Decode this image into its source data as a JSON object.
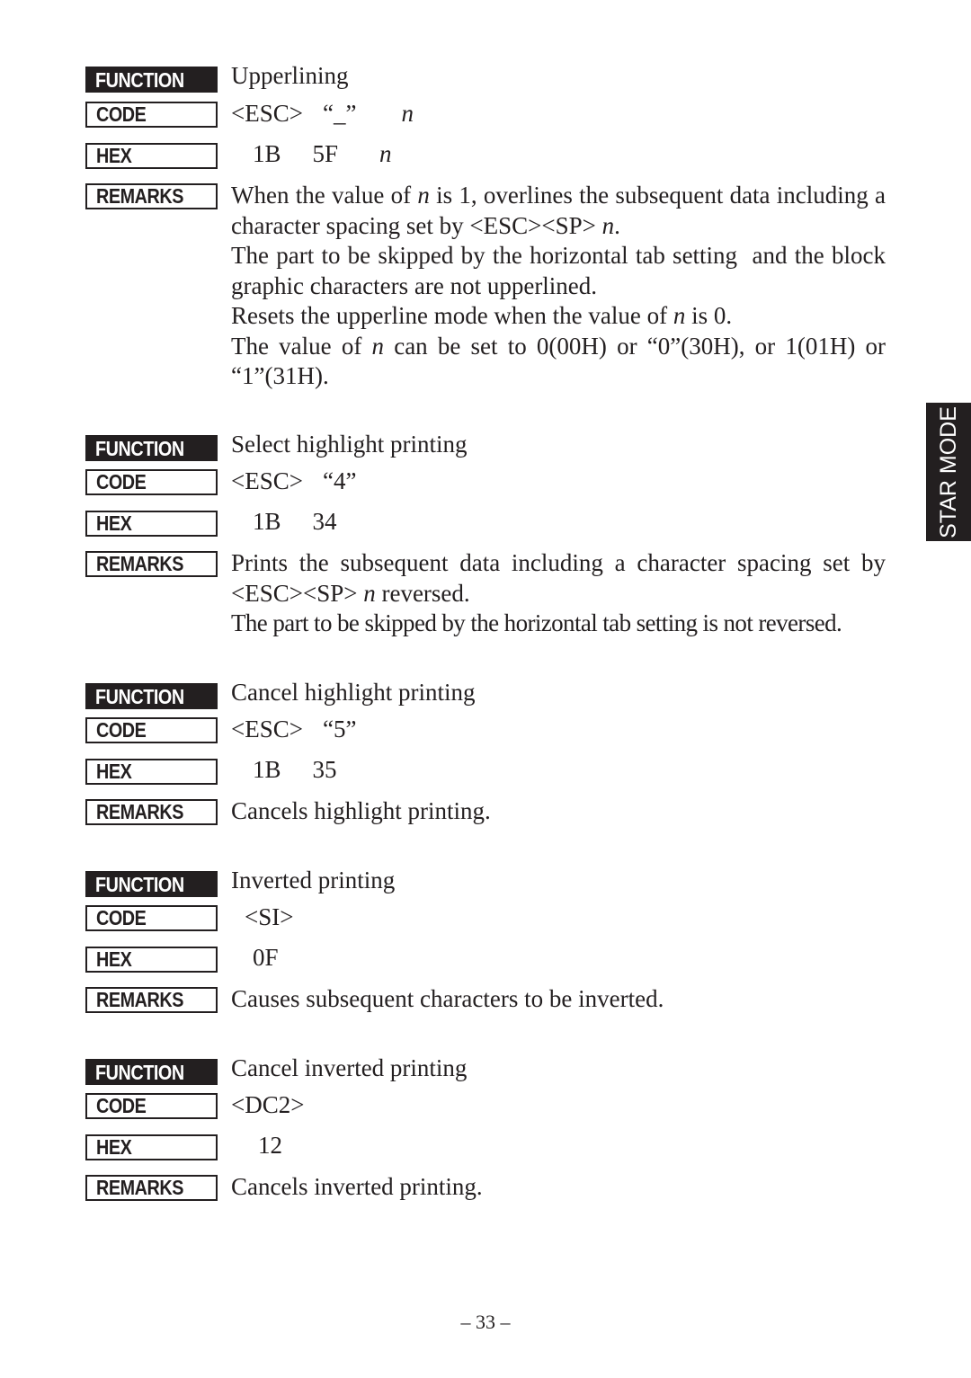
{
  "labels": {
    "function": "FUNCTION",
    "code": "CODE",
    "hex": "HEX",
    "remarks": "REMARKS"
  },
  "side_tab": "STAR MODE",
  "page_number": "– 33 –",
  "entries": [
    {
      "function": "Upperlining",
      "code": [
        "<ESC>",
        "“_”",
        "n"
      ],
      "hex": [
        "1B",
        "5F",
        "n"
      ],
      "remarks": [
        "When the value of n is 1, overlines the subsequent data including a character spacing set by <ESC><SP> n.",
        "The part to be skipped by the horizontal tab setting  and the block graphic characters are not upperlined.",
        "Resets the upperline mode when the value of n is 0.",
        "The value of n can be set to 0(00H) or “0”(30H), or 1(01H) or “1”(31H)."
      ]
    },
    {
      "function": "Select highlight printing",
      "code": [
        "<ESC>",
        "“4”"
      ],
      "hex": [
        "1B",
        "34"
      ],
      "remarks": [
        "Prints the subsequent data including a character spacing set by <ESC><SP> n reversed.",
        "The part to be skipped by the horizontal tab setting is not reversed."
      ]
    },
    {
      "function": "Cancel highlight printing",
      "code": [
        "<ESC>",
        "“5”"
      ],
      "hex": [
        "1B",
        "35"
      ],
      "remarks": [
        "Cancels highlight printing."
      ]
    },
    {
      "function": "Inverted printing",
      "code": [
        "<SI>"
      ],
      "hex": [
        "0F"
      ],
      "remarks": [
        "Causes subsequent characters to be inverted."
      ]
    },
    {
      "function": "Cancel inverted printing",
      "code": [
        "<DC2>"
      ],
      "hex": [
        "12"
      ],
      "remarks": [
        "Cancels inverted printing."
      ]
    }
  ]
}
